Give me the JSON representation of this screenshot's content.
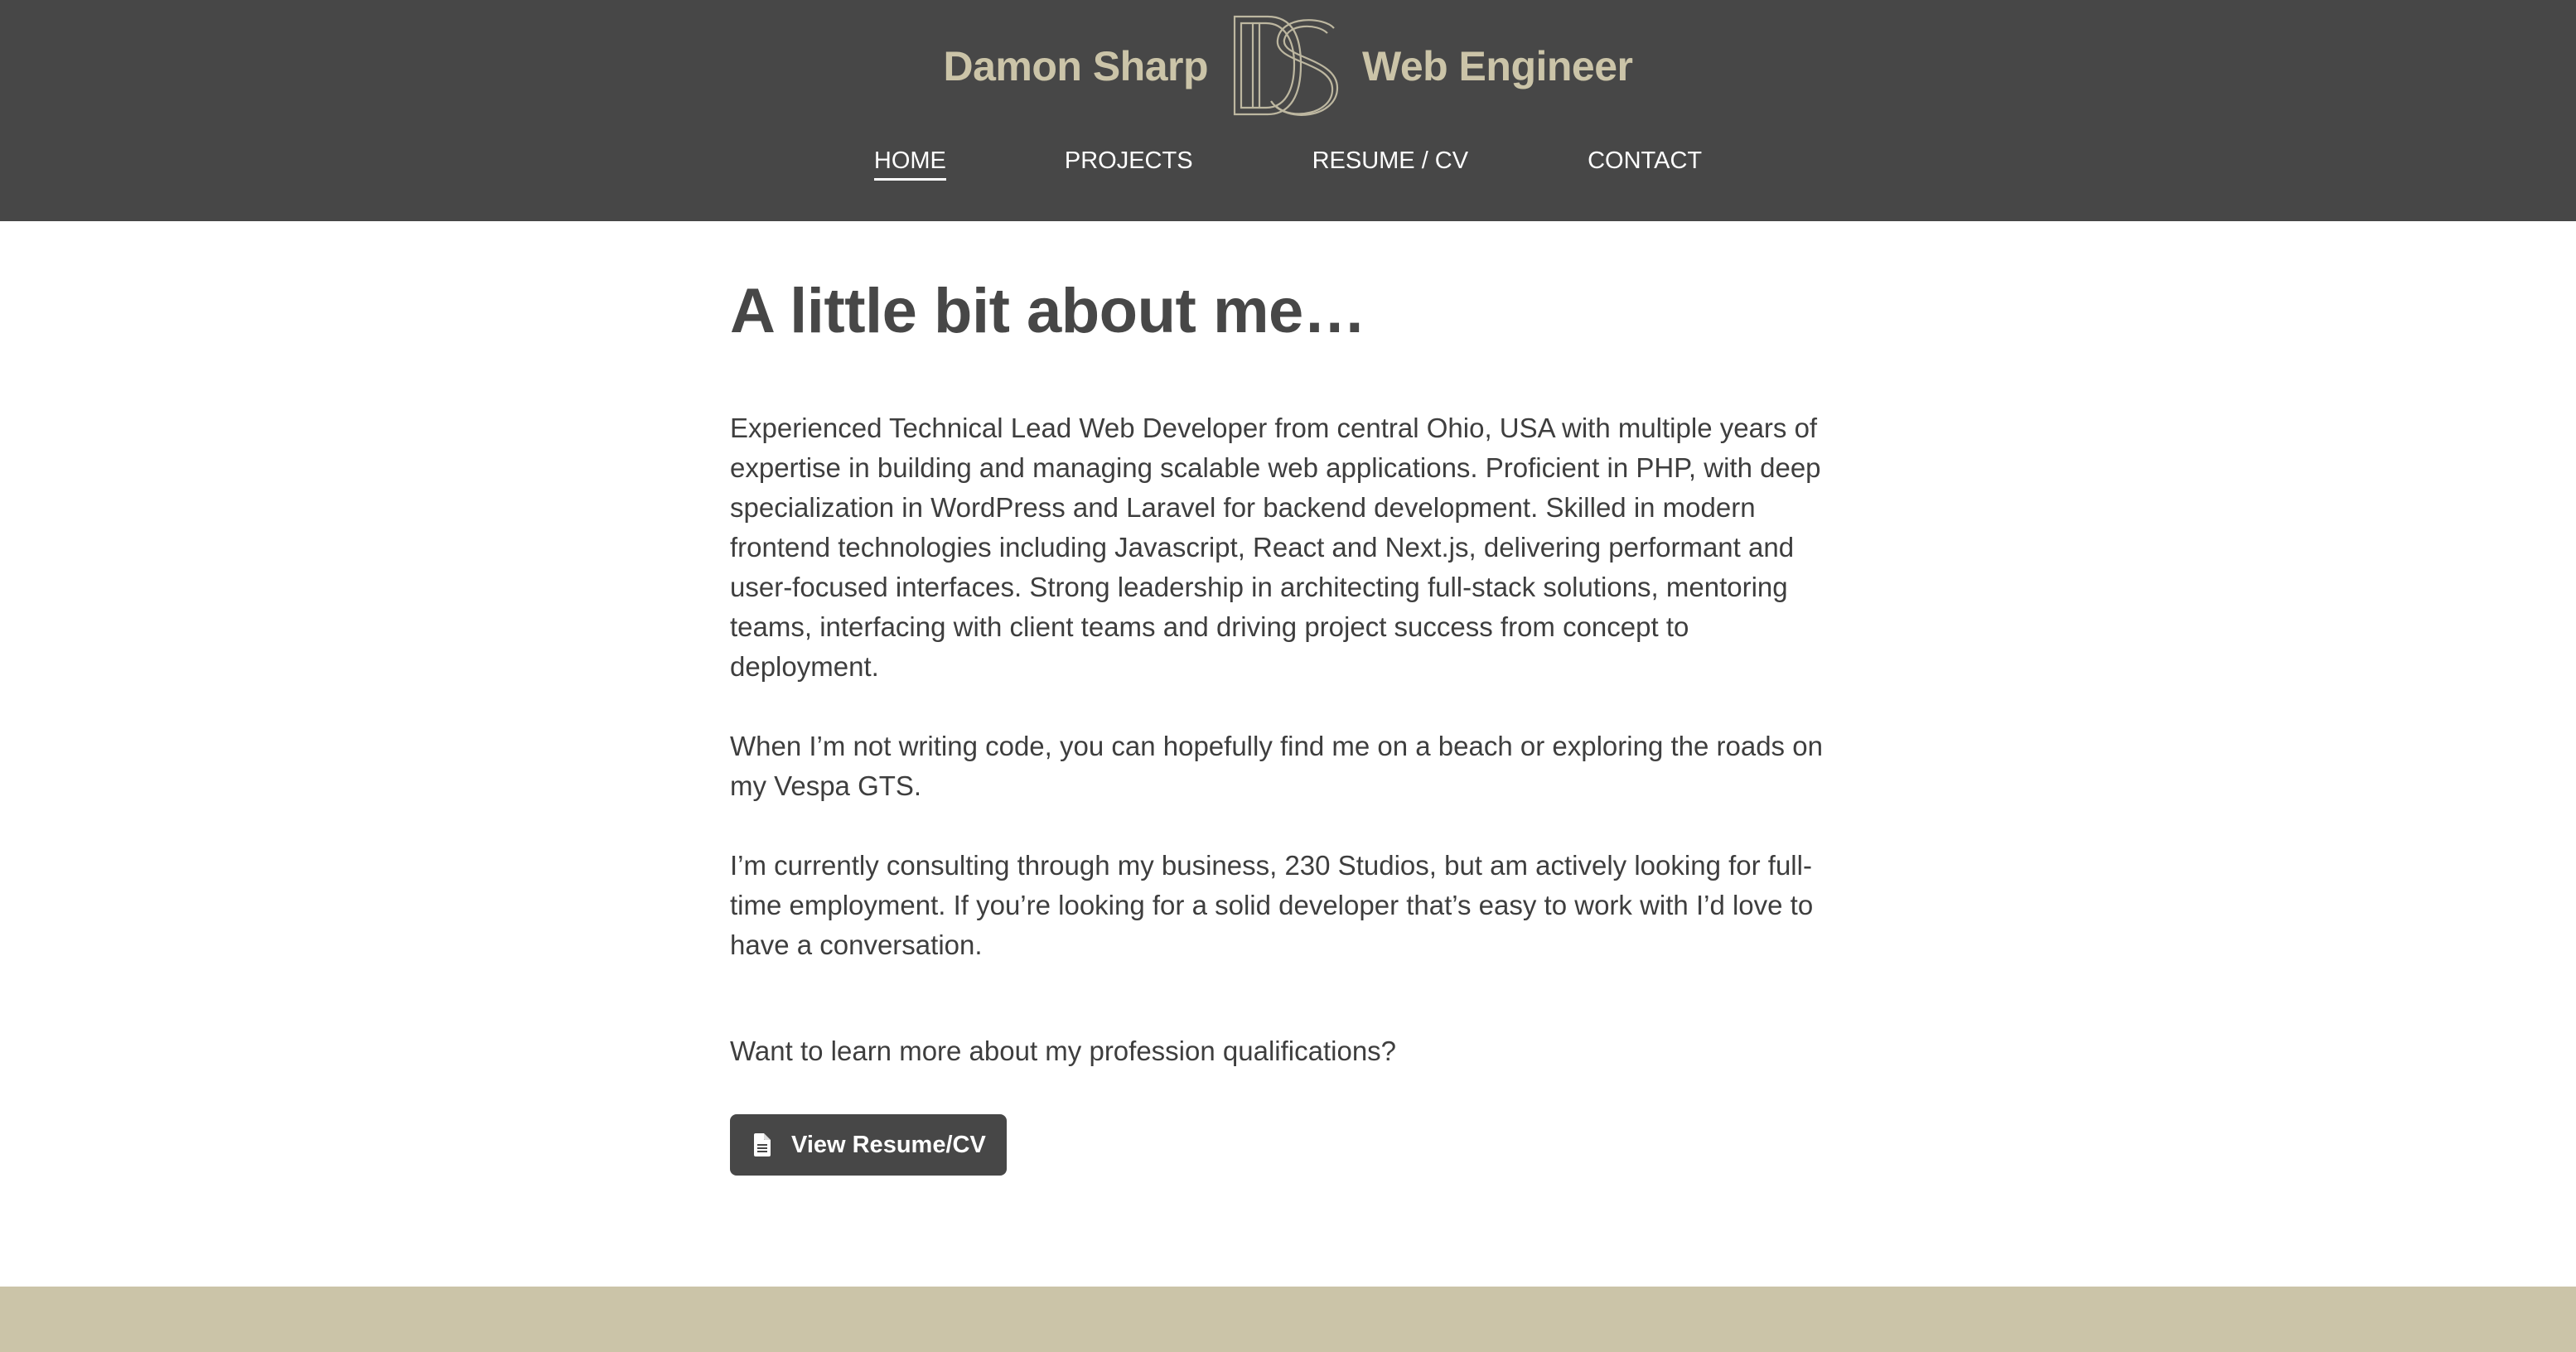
{
  "header": {
    "name": "Damon Sharp",
    "role": "Web Engineer",
    "logo_icon": "ds-monogram-logo"
  },
  "nav": {
    "items": [
      {
        "label": "HOME",
        "active": true
      },
      {
        "label": "PROJECTS",
        "active": false
      },
      {
        "label": "RESUME / CV",
        "active": false
      },
      {
        "label": "CONTACT",
        "active": false
      }
    ]
  },
  "main": {
    "title": "A little bit about me…",
    "paragraphs": [
      "Experienced Technical Lead Web Developer from central Ohio, USA with multiple years of expertise in building and managing scalable web applications. Proficient in PHP, with deep specialization in WordPress and Laravel for backend development. Skilled in modern frontend technologies including Javascript, React and Next.js, delivering performant and user-focused interfaces. Strong leadership in architecting full-stack solutions, mentoring teams, interfacing with client teams and driving project success from concept to deployment.",
      "When I’m not writing code, you can hopefully find me on a beach or exploring the roads on my Vespa GTS.",
      "I’m currently consulting through my business, 230 Studios, but am actively looking for full-time employment. If you’re looking for a solid developer that’s easy to work with I’d love to have a conversation.",
      "Want to learn more about my profession qualifications?"
    ],
    "cta_label": "View Resume/CV",
    "cta_icon": "document-icon"
  },
  "colors": {
    "header_bg": "#474747",
    "accent": "#cbc4a8",
    "text": "#3e3e3e"
  }
}
